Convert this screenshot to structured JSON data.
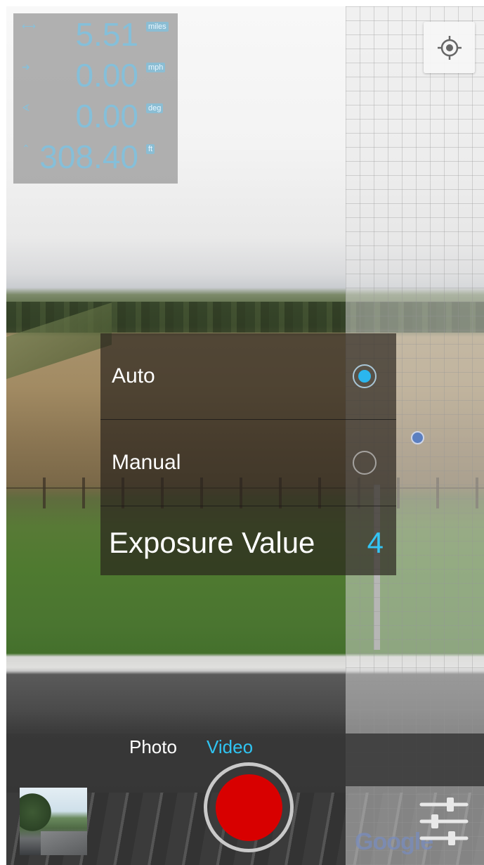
{
  "telemetry": {
    "distance": {
      "icon": "distance-icon",
      "value": "5.51",
      "unit": "miles"
    },
    "speed": {
      "icon": "speed-icon",
      "value": "0.00",
      "unit": "mph"
    },
    "heading": {
      "icon": "heading-icon",
      "value": "0.00",
      "unit": "deg"
    },
    "altitude": {
      "icon": "altitude-icon",
      "value": "308.40",
      "unit": "ft"
    }
  },
  "exposure_menu": {
    "options": [
      {
        "label": "Auto",
        "selected": true
      },
      {
        "label": "Manual",
        "selected": false
      }
    ],
    "ev_label": "Exposure Value",
    "ev_value": "4"
  },
  "capture_modes": {
    "photo": "Photo",
    "video": "Video",
    "active": "Video"
  },
  "map": {
    "attribution": "Google",
    "locate_icon": "my-location-icon",
    "marker_color": "#5b7fc0"
  },
  "controls": {
    "record_color": "#d80000",
    "accent_color": "#2fc4f2",
    "settings_icon": "sliders-icon",
    "thumbnail_label": "last-capture-thumbnail"
  }
}
